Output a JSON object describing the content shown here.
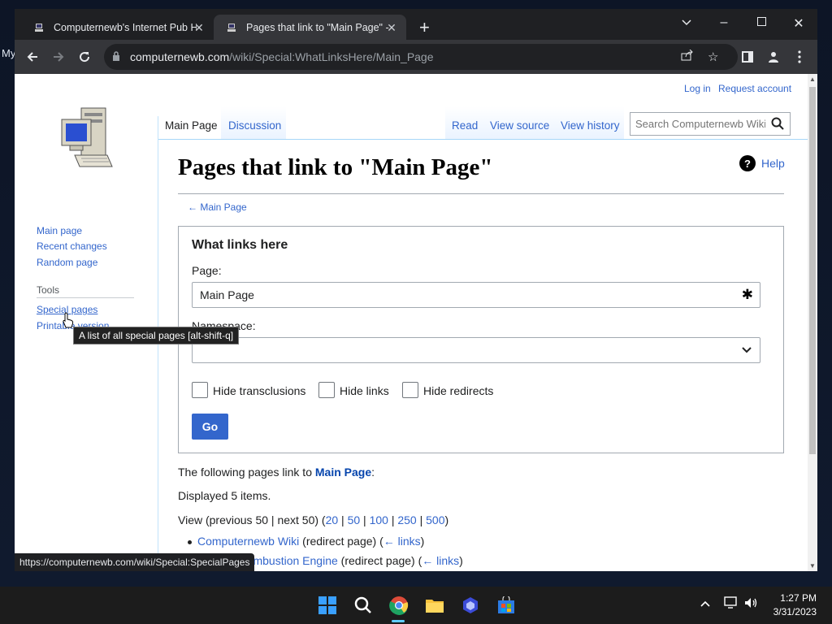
{
  "browser": {
    "tabs": [
      {
        "title": "Computernewb's Internet Pub Ho",
        "active": false
      },
      {
        "title": "Pages that link to \"Main Page\" - C",
        "active": true
      }
    ],
    "url_host": "computernewb.com",
    "url_path": "/wiki/Special:WhatLinksHere/Main_Page",
    "status_url": "https://computernewb.com/wiki/Special:SpecialPages"
  },
  "personal": {
    "login": "Log in",
    "request": "Request account"
  },
  "sidebar": {
    "items": [
      "Main page",
      "Recent changes",
      "Random page"
    ],
    "tools_heading": "Tools",
    "tools": [
      "Special pages",
      "Printable version"
    ],
    "tooltip": "A list of all special pages [alt-shift-q]"
  },
  "content_tabs": {
    "main": "Main Page",
    "discussion": "Discussion",
    "read": "Read",
    "view_source": "View source",
    "view_history": "View history"
  },
  "search": {
    "placeholder": "Search Computernewb Wiki"
  },
  "page": {
    "title": "Pages that link to \"Main Page\"",
    "help": "Help",
    "backlink": "← Main Page",
    "form": {
      "legend": "What links here",
      "page_label": "Page:",
      "page_value": "Main Page",
      "namespace_label": "Namespace:",
      "hide_transclusions": "Hide transclusions",
      "hide_links": "Hide links",
      "hide_redirects": "Hide redirects",
      "go": "Go"
    },
    "following_prefix": "The following pages link to ",
    "following_bold": "Main Page",
    "following_suffix": ":",
    "displayed": "Displayed 5 items.",
    "view": {
      "prefix": "View (previous 50 | next 50) (",
      "limits": [
        "20",
        "50",
        "100",
        "250",
        "500"
      ],
      "suffix": ")"
    },
    "results": [
      {
        "title": "Computernewb Wiki",
        "note": " (redirect page)  (",
        "links": "← links",
        "close": ")"
      },
      {
        "title": "Internal Combustion Engine",
        "note": " (redirect page)  (",
        "links": "← links",
        "close": ")"
      }
    ]
  },
  "taskbar": {
    "time": "1:27 PM",
    "date": "3/31/2023"
  }
}
